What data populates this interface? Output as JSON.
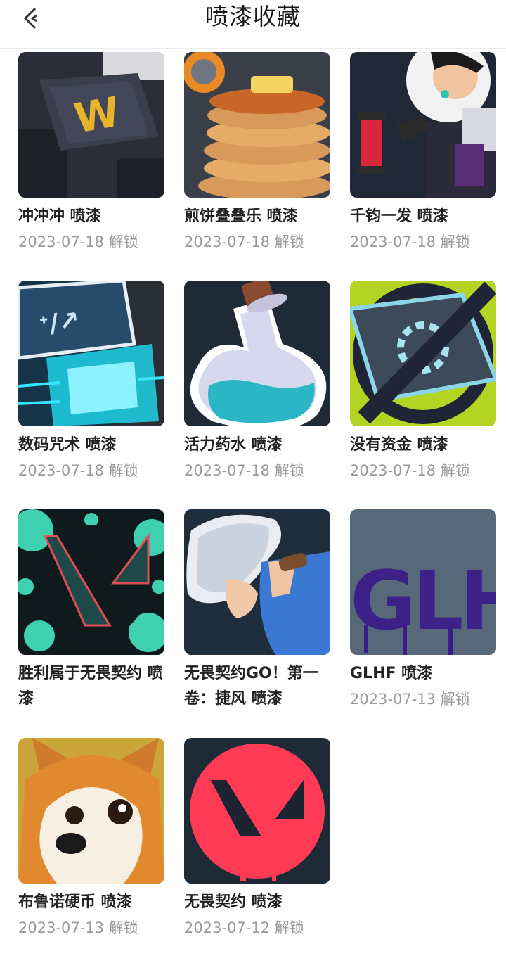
{
  "header": {
    "title": "喷漆收藏",
    "back_icon": "chevron-left-icon"
  },
  "sprays": [
    {
      "name": "冲冲冲 喷漆",
      "date": "2023-07-18 解锁",
      "art": "keycap-w"
    },
    {
      "name": "煎饼叠叠乐 喷漆",
      "date": "2023-07-18 解锁",
      "art": "pancakes"
    },
    {
      "name": "千钧一发 喷漆",
      "date": "2023-07-18 解锁",
      "art": "character-bomb"
    },
    {
      "name": "数码咒术 喷漆",
      "date": "2023-07-18 解锁",
      "art": "circuit-chip"
    },
    {
      "name": "活力药水 喷漆",
      "date": "2023-07-18 解锁",
      "art": "potion"
    },
    {
      "name": "没有资金 喷漆",
      "date": "2023-07-18 解锁",
      "art": "no-money"
    },
    {
      "name": "胜利属于无畏契约 喷漆",
      "date": "",
      "art": "valorant-splatter"
    },
    {
      "name": "无畏契约GO！第一卷：捷风 喷漆",
      "date": "",
      "art": "jett"
    },
    {
      "name": "GLHF 喷漆",
      "date": "2023-07-13 解锁",
      "art": "glhf-graffiti"
    },
    {
      "name": "布鲁诺硬币 喷漆",
      "date": "2023-07-13 解锁",
      "art": "shiba-dog"
    },
    {
      "name": "无畏契约 喷漆",
      "date": "2023-07-12 解锁",
      "art": "valorant-logo"
    }
  ],
  "colors": {
    "background": "#ffffff",
    "name_text": "#222222",
    "date_text": "#9a9a9a"
  }
}
